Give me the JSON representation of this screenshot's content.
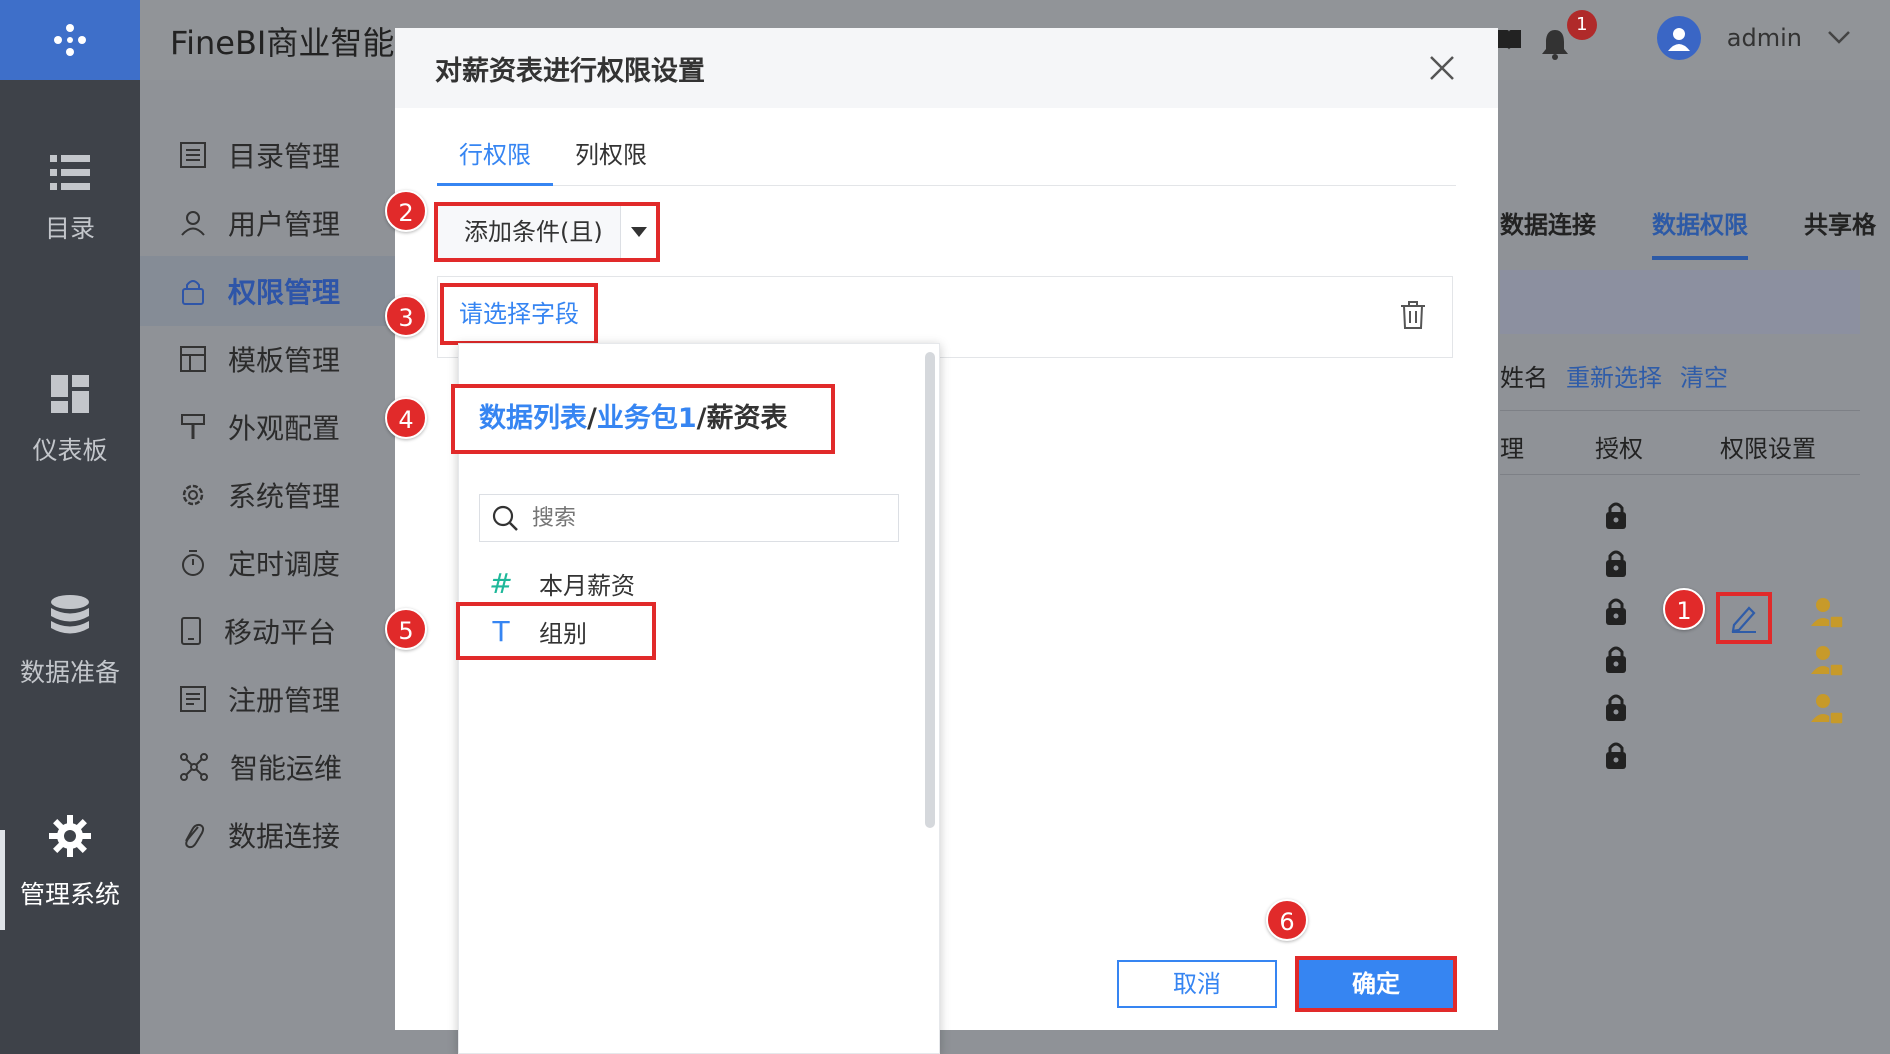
{
  "app": {
    "title": "FineBI商业智能",
    "username": "admin",
    "notification_count": "1"
  },
  "nav": {
    "items": [
      {
        "label": "目录",
        "icon": "list-icon"
      },
      {
        "label": "仪表板",
        "icon": "dashboard-icon"
      },
      {
        "label": "数据准备",
        "icon": "database-icon"
      },
      {
        "label": "管理系统",
        "icon": "gear-icon"
      }
    ]
  },
  "submenu": {
    "items": [
      {
        "label": "目录管理",
        "icon": "catalog-icon"
      },
      {
        "label": "用户管理",
        "icon": "user-icon"
      },
      {
        "label": "权限管理",
        "icon": "lock-icon"
      },
      {
        "label": "模板管理",
        "icon": "template-icon"
      },
      {
        "label": "外观配置",
        "icon": "brush-icon"
      },
      {
        "label": "系统管理",
        "icon": "settings-icon"
      },
      {
        "label": "定时调度",
        "icon": "timer-icon"
      },
      {
        "label": "移动平台",
        "icon": "mobile-icon"
      },
      {
        "label": "注册管理",
        "icon": "register-icon"
      },
      {
        "label": "智能运维",
        "icon": "ops-icon"
      },
      {
        "label": "数据连接",
        "icon": "link-icon"
      }
    ]
  },
  "background_panel": {
    "tabs": [
      "数据连接",
      "数据权限",
      "共享格"
    ],
    "links": {
      "name_fragment": "姓名",
      "reselect": "重新选择",
      "clear": "清空"
    },
    "columns": [
      "理",
      "授权",
      "权限设置"
    ]
  },
  "dialog": {
    "title": "对薪资表进行权限设置",
    "tabs": [
      "行权限",
      "列权限"
    ],
    "add_condition": "添加条件(且)",
    "field_placeholder": "请选择字段",
    "dropdown": {
      "path_parts": [
        "数据列表",
        "/",
        "业务包1",
        "/",
        "薪资表"
      ],
      "search_placeholder": "搜索",
      "fields": [
        {
          "name": "本月薪资",
          "type_symbol": "#"
        },
        {
          "name": "组别",
          "type_symbol": "T"
        }
      ]
    },
    "cancel_label": "取消",
    "ok_label": "确定"
  },
  "steps": [
    "1",
    "2",
    "3",
    "4",
    "5",
    "6"
  ],
  "colors": {
    "accent": "#3685f2",
    "annotation": "#e12a2a",
    "nav_bg": "#3e4249"
  }
}
